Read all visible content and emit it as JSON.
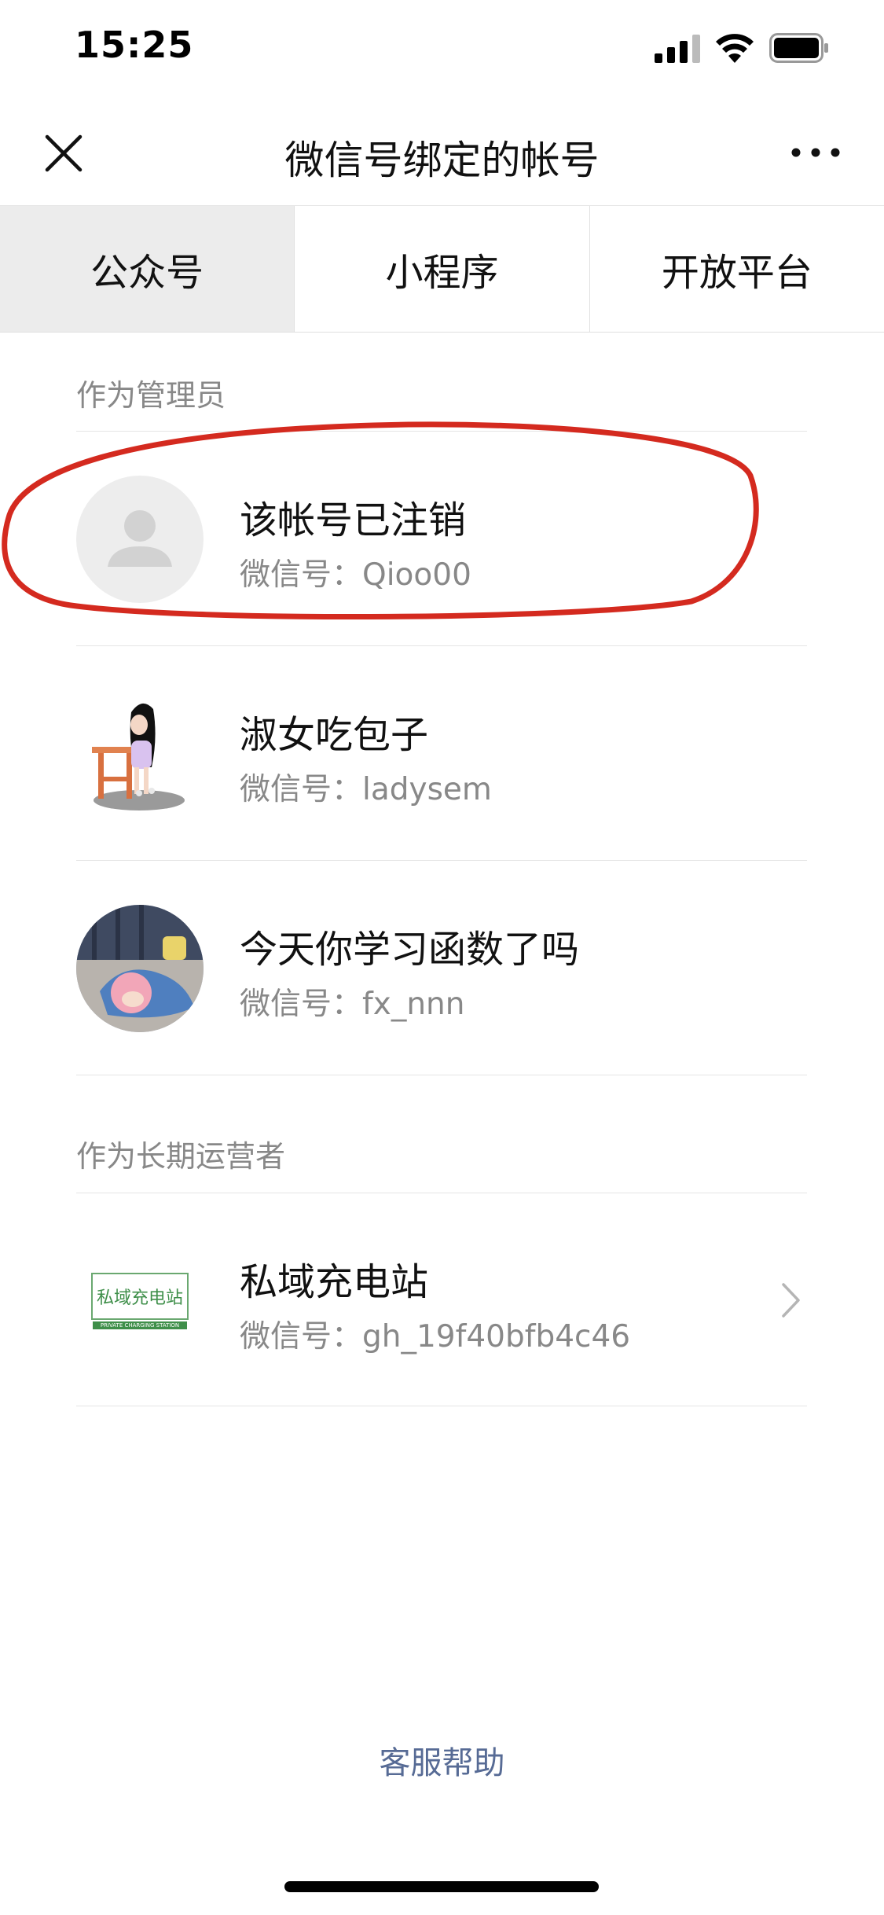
{
  "status_bar": {
    "time": "15:25"
  },
  "nav": {
    "title": "微信号绑定的帐号"
  },
  "tabs": [
    {
      "label": "公众号",
      "active": true
    },
    {
      "label": "小程序",
      "active": false
    },
    {
      "label": "开放平台",
      "active": false
    }
  ],
  "sections": {
    "admin": {
      "title": "作为管理员",
      "items": [
        {
          "name": "该帐号已注销",
          "id_label": "微信号：",
          "id": "Qioo00",
          "avatar": "default-avatar"
        },
        {
          "name": "淑女吃包子",
          "id_label": "微信号：",
          "id": "ladysem",
          "avatar": "girl-at-desk-avatar"
        },
        {
          "name": "今天你学习函数了吗",
          "id_label": "微信号：",
          "id": "fx_nnn",
          "avatar": "anime-girl-avatar"
        }
      ]
    },
    "operator": {
      "title": "作为长期运营者",
      "items": [
        {
          "name": "私域充电站",
          "id_label": "微信号：",
          "id": "gh_19f40bfb4c46",
          "avatar": "brand-logo-avatar",
          "logo_text": "私域充电站",
          "logo_subtext": "PRIVATE CHARGING STATION"
        }
      ]
    }
  },
  "footer": {
    "help": "客服帮助"
  },
  "colors": {
    "link": "#576b95",
    "annotation": "#d42a1f",
    "tab_active_bg": "#ececec"
  }
}
